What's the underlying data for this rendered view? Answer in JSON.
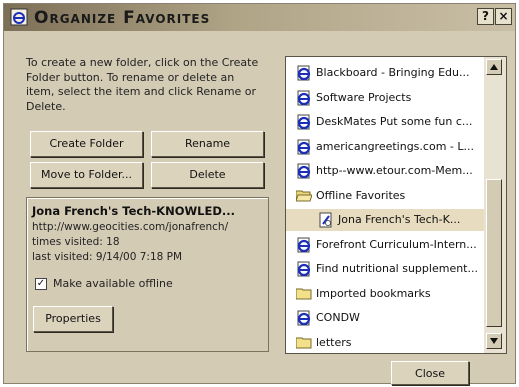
{
  "window": {
    "title": "Organize Favorites",
    "help_label": "?",
    "close_label": "×"
  },
  "instructions": "To create a new folder, click on the Create Folder button. To rename or delete an item, select the item and click Rename or Delete.",
  "buttons": {
    "create_folder": "Create Folder",
    "rename": "Rename",
    "move_to_folder": "Move to Folder...",
    "delete": "Delete",
    "properties": "Properties",
    "close": "Close"
  },
  "details": {
    "name": "Jona French's Tech-KNOWLED...",
    "url": "http://www.geocities.com/jonafrench/",
    "times_visited": "times visited: 18",
    "last_visited": "last visited: 9/14/00 7:18 PM",
    "offline_label": "Make available offline",
    "offline_checked": true
  },
  "tree": [
    {
      "label": "Blackboard - Bringing Edu...",
      "icon": "ie-page-icon",
      "selected": false
    },
    {
      "label": "Software Projects",
      "icon": "ie-page-icon",
      "selected": false
    },
    {
      "label": "DeskMates Put some fun c...",
      "icon": "ie-page-icon",
      "selected": false
    },
    {
      "label": "americangreetings.com - L...",
      "icon": "ie-page-icon",
      "selected": false
    },
    {
      "label": "http--www.etour.com-Mem...",
      "icon": "ie-page-icon",
      "selected": false
    },
    {
      "label": "Offline Favorites",
      "icon": "open-folder-icon",
      "selected": false
    },
    {
      "label": "Jona French's Tech-K...",
      "icon": "offline-page-icon",
      "selected": true
    },
    {
      "label": "Forefront Curriculum-Intern...",
      "icon": "ie-page-icon",
      "selected": false
    },
    {
      "label": "Find nutritional supplement...",
      "icon": "ie-page-icon",
      "selected": false
    },
    {
      "label": "Imported bookmarks",
      "icon": "folder-icon",
      "selected": false
    },
    {
      "label": "CONDW",
      "icon": "ie-page-icon",
      "selected": false
    },
    {
      "label": "letters",
      "icon": "folder-icon",
      "selected": false
    }
  ],
  "colors": {
    "face": "#d4cbb5",
    "titlebar": "#7c6f57",
    "selection": "#e8dcc0",
    "ie_blue": "#1c2fb8"
  }
}
